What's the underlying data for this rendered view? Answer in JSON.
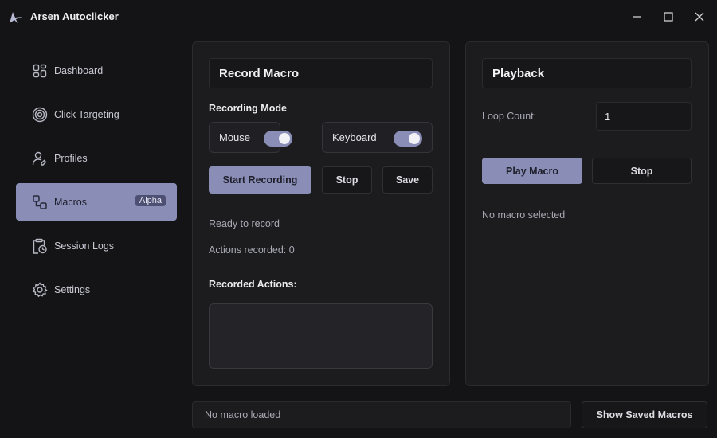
{
  "window": {
    "title": "Arsen Autoclicker"
  },
  "sidebar": {
    "items": [
      {
        "label": "Dashboard",
        "icon": "dashboard-icon",
        "active": false
      },
      {
        "label": "Click Targeting",
        "icon": "target-icon",
        "active": false
      },
      {
        "label": "Profiles",
        "icon": "profile-icon",
        "active": false
      },
      {
        "label": "Macros",
        "icon": "macros-icon",
        "active": true,
        "badge": "Alpha"
      },
      {
        "label": "Session Logs",
        "icon": "session-logs-icon",
        "active": false
      },
      {
        "label": "Settings",
        "icon": "gear-icon",
        "active": false
      }
    ]
  },
  "record": {
    "title": "Record Macro",
    "mode_label": "Recording Mode",
    "mouse_label": "Mouse",
    "mouse_enabled": true,
    "keyboard_label": "Keyboard",
    "keyboard_enabled": true,
    "start_label": "Start Recording",
    "stop_label": "Stop",
    "save_label": "Save",
    "status": "Ready to record",
    "actions_count": "Actions recorded: 0",
    "recorded_label": "Recorded Actions:"
  },
  "playback": {
    "title": "Playback",
    "loop_label": "Loop Count:",
    "loop_value": "1",
    "play_label": "Play Macro",
    "stop_label": "Stop",
    "status": "No macro selected"
  },
  "footer": {
    "status": "No macro loaded",
    "saved_button": "Show Saved Macros"
  },
  "colors": {
    "accent": "#8a8eb6",
    "background": "#141416",
    "panel": "#1c1c1f"
  }
}
